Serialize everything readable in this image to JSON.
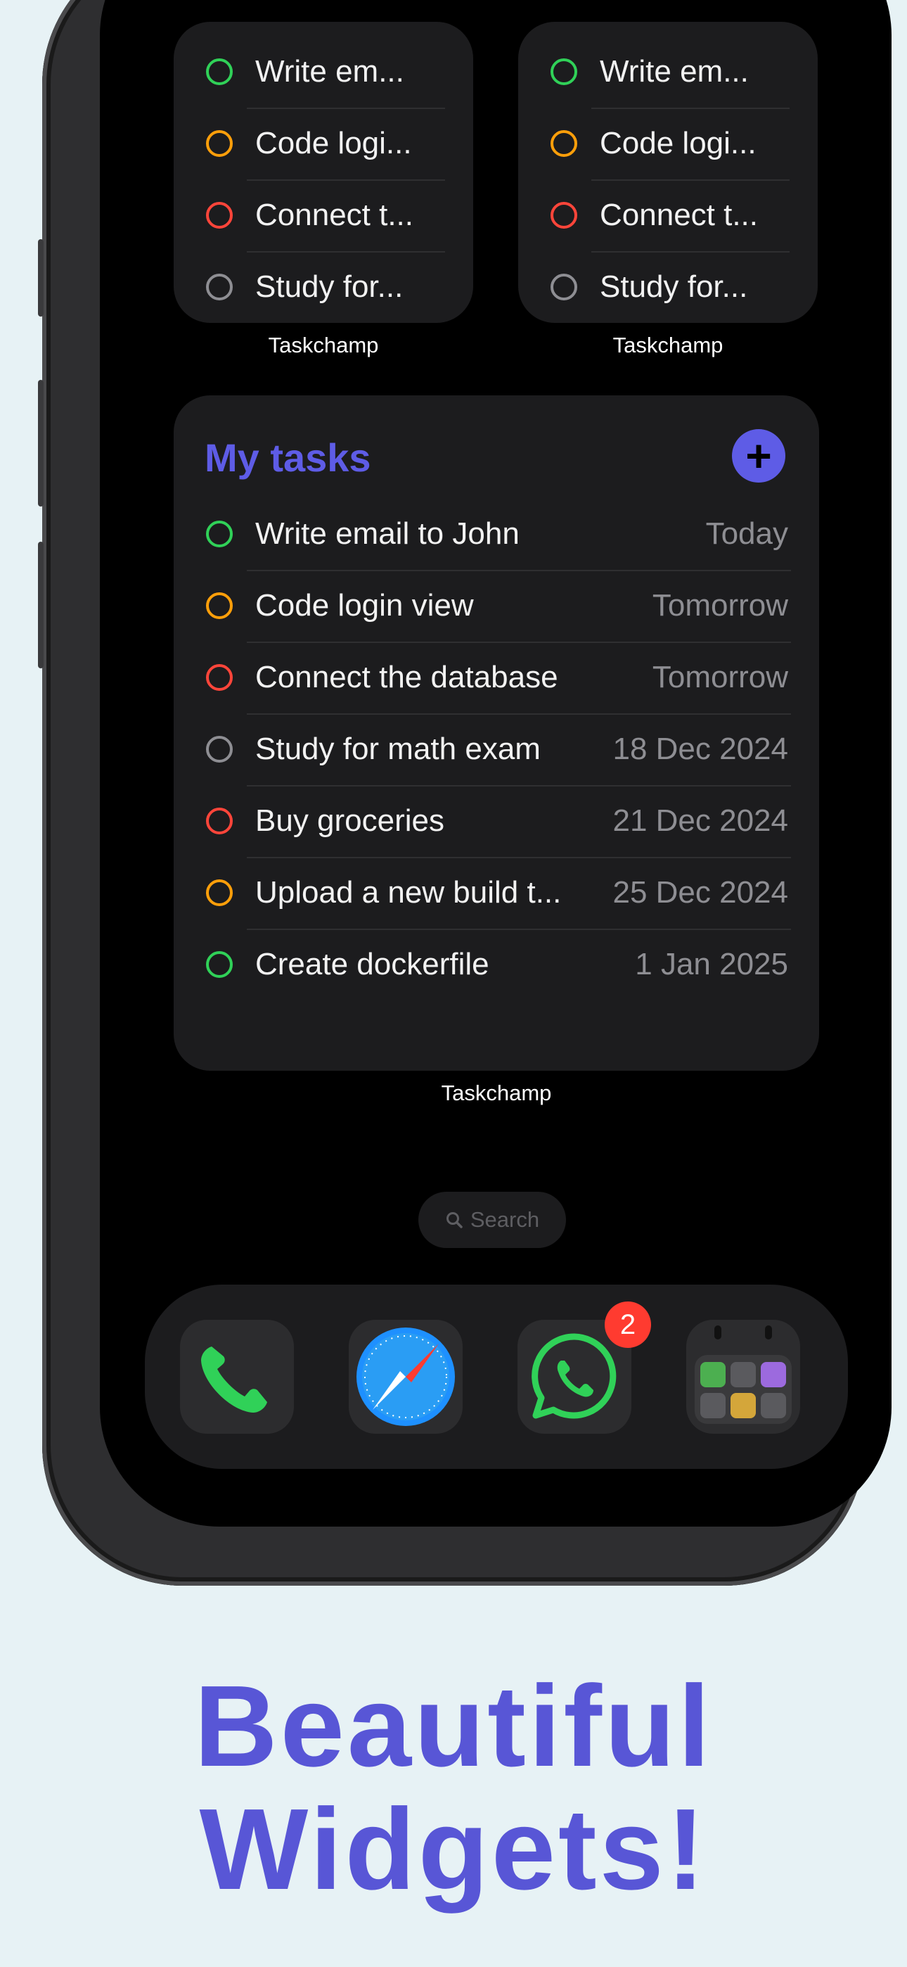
{
  "small_widgets": [
    {
      "tasks": [
        {
          "title": "Write em...",
          "color": "#30d158"
        },
        {
          "title": "Code logi...",
          "color": "#ff9f0a"
        },
        {
          "title": "Connect t...",
          "color": "#ff453a"
        },
        {
          "title": "Study for...",
          "color": "#8e8e93"
        }
      ],
      "label": "Taskchamp"
    },
    {
      "tasks": [
        {
          "title": "Write em...",
          "color": "#30d158"
        },
        {
          "title": "Code logi...",
          "color": "#ff9f0a"
        },
        {
          "title": "Connect t...",
          "color": "#ff453a"
        },
        {
          "title": "Study for...",
          "color": "#8e8e93"
        }
      ],
      "label": "Taskchamp"
    }
  ],
  "large_widget": {
    "title": "My tasks",
    "add_label": "+",
    "label": "Taskchamp",
    "tasks": [
      {
        "title": "Write email to John",
        "date": "Today",
        "color": "#30d158"
      },
      {
        "title": "Code login view",
        "date": "Tomorrow",
        "color": "#ff9f0a"
      },
      {
        "title": "Connect the database",
        "date": "Tomorrow",
        "color": "#ff453a"
      },
      {
        "title": "Study for math exam",
        "date": "18 Dec 2024",
        "color": "#8e8e93"
      },
      {
        "title": "Buy groceries",
        "date": "21 Dec 2024",
        "color": "#ff453a"
      },
      {
        "title": "Upload a new build t...",
        "date": "25 Dec 2024",
        "color": "#ff9f0a"
      },
      {
        "title": "Create dockerfile",
        "date": "1 Jan 2025",
        "color": "#30d158"
      }
    ]
  },
  "search": {
    "label": "Search"
  },
  "dock": {
    "apps": [
      {
        "name": "phone-icon"
      },
      {
        "name": "safari-icon"
      },
      {
        "name": "whatsapp-icon",
        "badge": "2"
      },
      {
        "name": "utilities-folder-icon"
      }
    ]
  },
  "headline": {
    "line1": "Beautiful",
    "line2": "Widgets!"
  },
  "colors": {
    "accent": "#5e5ce6",
    "background": "#e7f2f5"
  }
}
